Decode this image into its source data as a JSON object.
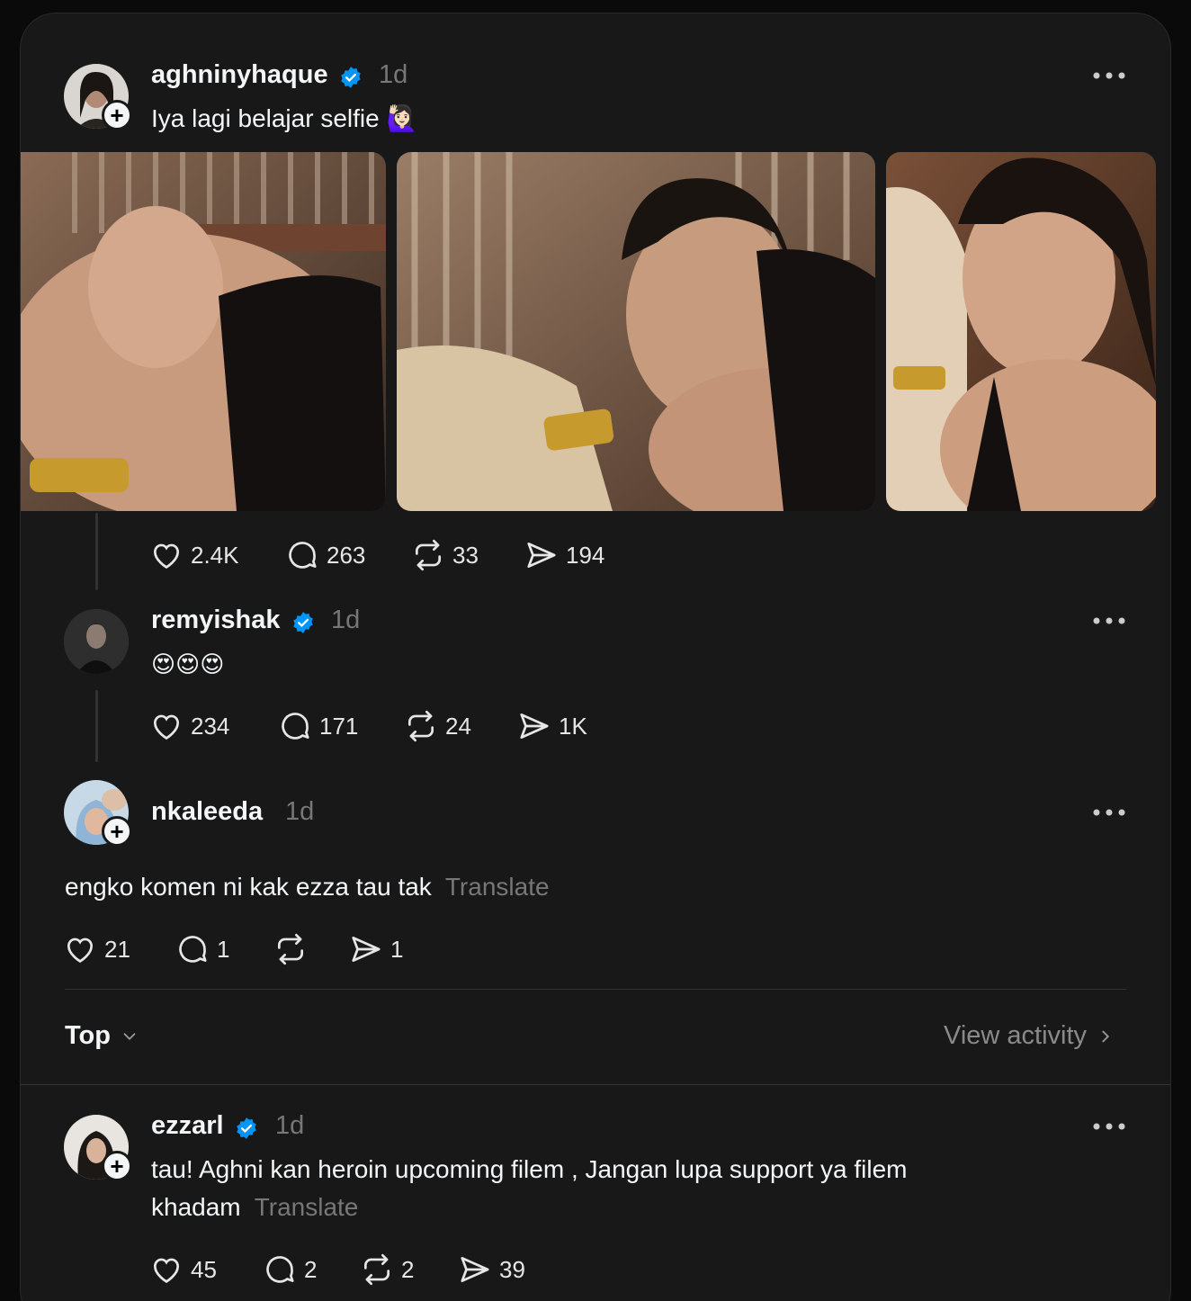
{
  "post": {
    "username": "aghninyhaque",
    "time": "1d",
    "text": "Iya lagi belajar selfie 🙋🏻‍♀️",
    "stats": {
      "likes": "2.4K",
      "replies": "263",
      "reposts": "33",
      "shares": "194"
    }
  },
  "replies": [
    {
      "username": "remyishak",
      "time": "1d",
      "text": "😍😍😍",
      "stats": {
        "likes": "234",
        "replies": "171",
        "reposts": "24",
        "shares": "1K"
      }
    },
    {
      "username": "nkaleeda",
      "time": "1d",
      "text": "engko komen ni kak ezza tau tak",
      "translate": "Translate",
      "stats": {
        "likes": "21",
        "replies": "1",
        "reposts": "",
        "shares": "1"
      }
    }
  ],
  "sort": {
    "label": "Top",
    "view_activity": "View activity"
  },
  "comments": [
    {
      "username": "ezzarl",
      "time": "1d",
      "text_line1": "tau! Aghni kan heroin upcoming filem , Jangan lupa support ya filem",
      "text_line2": "khadam",
      "translate": "Translate",
      "stats": {
        "likes": "45",
        "replies": "2",
        "reposts": "2",
        "shares": "39"
      }
    }
  ],
  "colors": {
    "background": "#181818",
    "accent_verified": "#0095f6",
    "muted": "#777777"
  }
}
